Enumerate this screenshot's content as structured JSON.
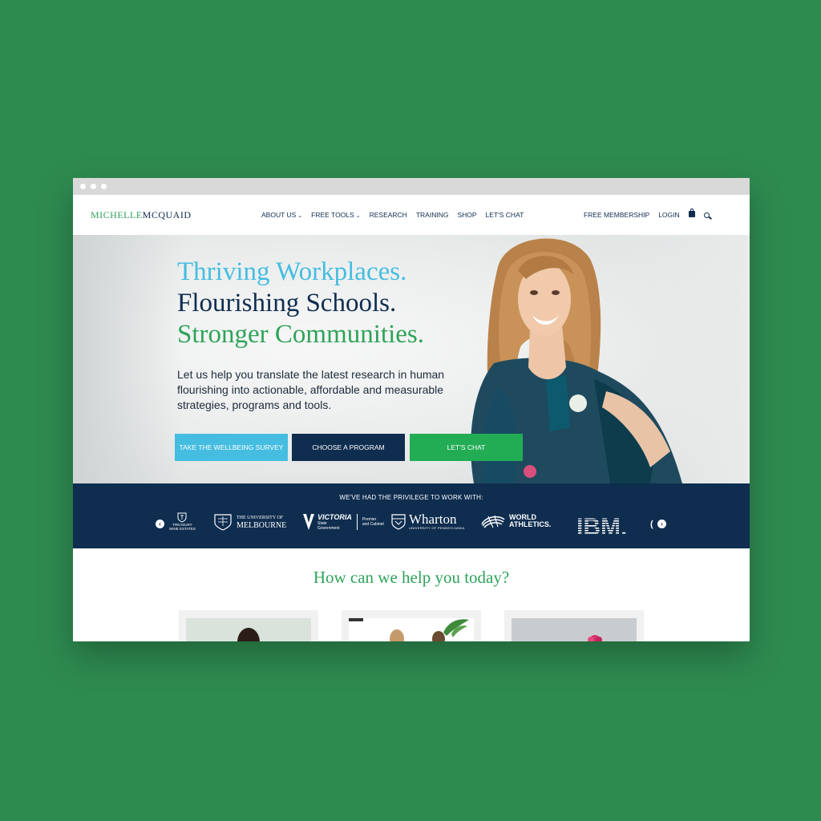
{
  "colors": {
    "page_background": "#2e8b50",
    "navy": "#0f2d4f",
    "blue": "#45bde0",
    "green": "#2fa35a",
    "button_green": "#22ad55"
  },
  "logo": {
    "first": "MICHELLE",
    "second": "MCQUAID"
  },
  "nav": {
    "items": [
      {
        "label": "ABOUT US",
        "has_dropdown": true
      },
      {
        "label": "FREE TOOLS",
        "has_dropdown": true
      },
      {
        "label": "RESEARCH"
      },
      {
        "label": "TRAINING"
      },
      {
        "label": "SHOP"
      },
      {
        "label": "LET'S CHAT"
      }
    ],
    "caret": "⌄",
    "free_membership": "FREE MEMBERSHIP",
    "login": "LOGIN",
    "cart_icon": "shopping-bag-icon",
    "search_icon": "search-icon"
  },
  "hero": {
    "line1": "Thriving Workplaces.",
    "line2": "Flourishing Schools.",
    "line3": "Stronger Communities.",
    "subtitle": "Let us help you translate the latest research in human flourishing into actionable, affordable and measurable strategies, programs and tools.",
    "buttons": {
      "survey": "TAKE THE WELLBEING SURVEY",
      "program": "CHOOSE A PROGRAM",
      "chat": "LET'S CHAT"
    }
  },
  "clients": {
    "heading": "WE'VE HAD THE PRIVILEGE TO WORK WITH:",
    "prev_icon": "‹",
    "next_icon": "›",
    "treasury": {
      "line1": "TREASURY",
      "line2": "WINE ESTATES"
    },
    "melbourne": {
      "small": "THE UNIVERSITY OF",
      "big": "MELBOURNE"
    },
    "victoria": {
      "name": "VICTORIA",
      "sub1": "State",
      "sub2": "Government",
      "dept1": "Premier",
      "dept2": "and Cabinet"
    },
    "wharton": {
      "big": "Wharton",
      "small": "UNIVERSITY OF PENNSYLVANIA"
    },
    "world_athletics": {
      "line1": "WORLD",
      "line2": "ATHLETICS."
    },
    "ibm": "IBM.",
    "partial": "("
  },
  "help": {
    "title": "How can we help you today?"
  }
}
